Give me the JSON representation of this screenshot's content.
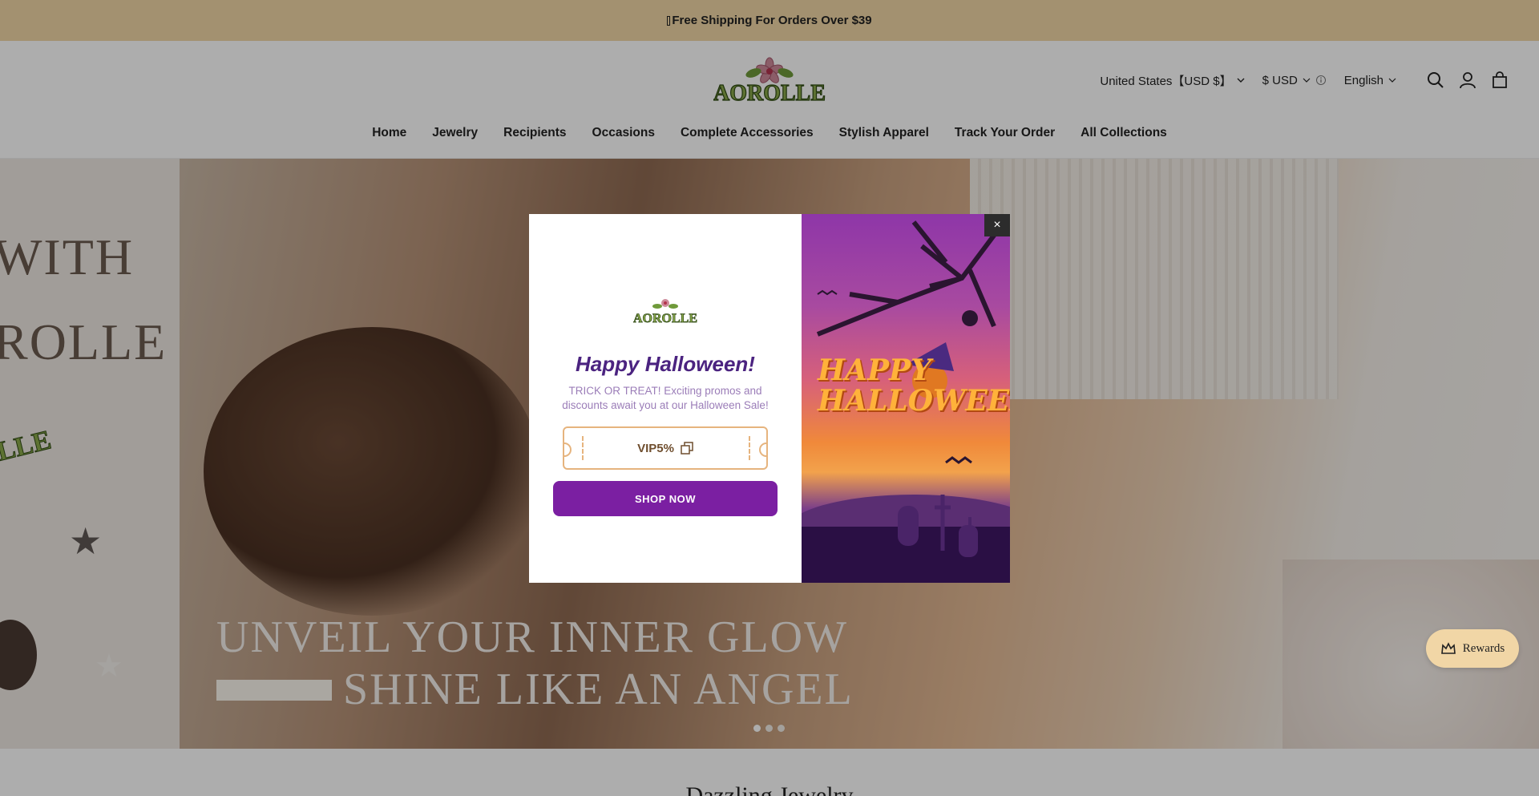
{
  "announcement": {
    "text": "Free Shipping For Orders Over $39",
    "icon": "truck-icon"
  },
  "header": {
    "logo_text": "AOROLLE",
    "region_selector": "United States【USD $】",
    "currency_selector": "$ USD",
    "language_selector": "English"
  },
  "nav": {
    "items": [
      "Home",
      "Jewelry",
      "Recipients",
      "Occasions",
      "Complete Accessories",
      "Stylish Apparel",
      "Track Your Order",
      "All Collections"
    ]
  },
  "hero": {
    "side_text_1": "WITH",
    "side_text_2": "ROLLE",
    "side_logo_text": "LLE",
    "headline_1": "UNVEIL YOUR INNER GLOW",
    "headline_2": "SHINE LIKE AN ANGEL",
    "slide_count": 3,
    "active_slide": 1
  },
  "section": {
    "title": "Dazzling Jewelry"
  },
  "rewards": {
    "label": "Rewards"
  },
  "modal": {
    "logo_text": "AOROLLE",
    "title": "Happy Halloween!",
    "description": "TRICK OR TREAT! Exciting promos and discounts await you at our Halloween Sale!",
    "coupon_code": "VIP5%",
    "cta_label": "SHOP NOW",
    "image_text_1": "HAPPY",
    "image_text_2": "HALLOWEEN",
    "close_label": "×"
  },
  "colors": {
    "announcement_bg": "#f0d6a5",
    "modal_title": "#4b2380",
    "cta_bg": "#7b1fa2",
    "coupon_border": "#e6b47e",
    "rewards_bg": "#f1d6a6"
  }
}
